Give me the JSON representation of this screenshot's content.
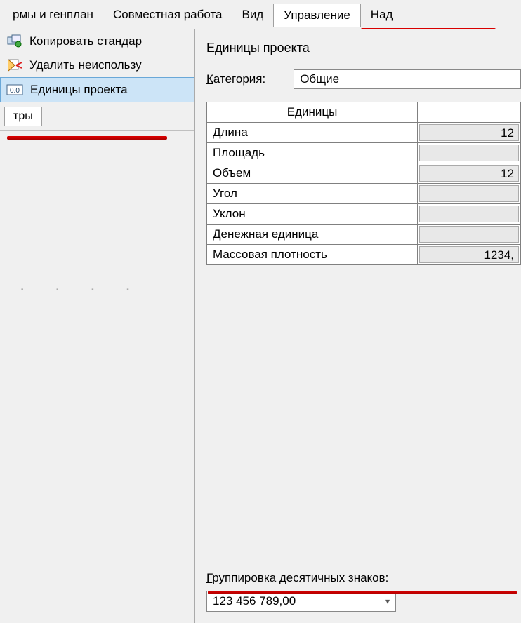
{
  "menubar": {
    "items": [
      "рмы и генплан",
      "Совместная работа",
      "Вид",
      "Управление",
      "Над"
    ],
    "active_index": 3
  },
  "left_panel": {
    "items": [
      {
        "label": "Копировать стандар",
        "icon": "copy-standards-icon"
      },
      {
        "label": "Удалить неиспользу",
        "icon": "purge-unused-icon"
      },
      {
        "label": "Единицы проекта",
        "icon": "project-units-icon",
        "selected": true
      }
    ],
    "tab_label": "тры"
  },
  "dialog": {
    "title": "Единицы проекта",
    "category_label_prefix": "К",
    "category_label_rest": "атегория:",
    "category_value": "Общие",
    "table": {
      "header_units": "Единицы",
      "rows": [
        {
          "name": "Длина",
          "value": "12"
        },
        {
          "name": "Площадь",
          "value": ""
        },
        {
          "name": "Объем",
          "value": "12"
        },
        {
          "name": "Угол",
          "value": ""
        },
        {
          "name": "Уклон",
          "value": ""
        },
        {
          "name": "Денежная единица",
          "value": ""
        },
        {
          "name": "Массовая плотность",
          "value": "1234,"
        }
      ]
    },
    "grouping": {
      "label_prefix": "Г",
      "label_rest": "руппировка десятичных знаков:",
      "value": "123 456 789,00"
    }
  }
}
